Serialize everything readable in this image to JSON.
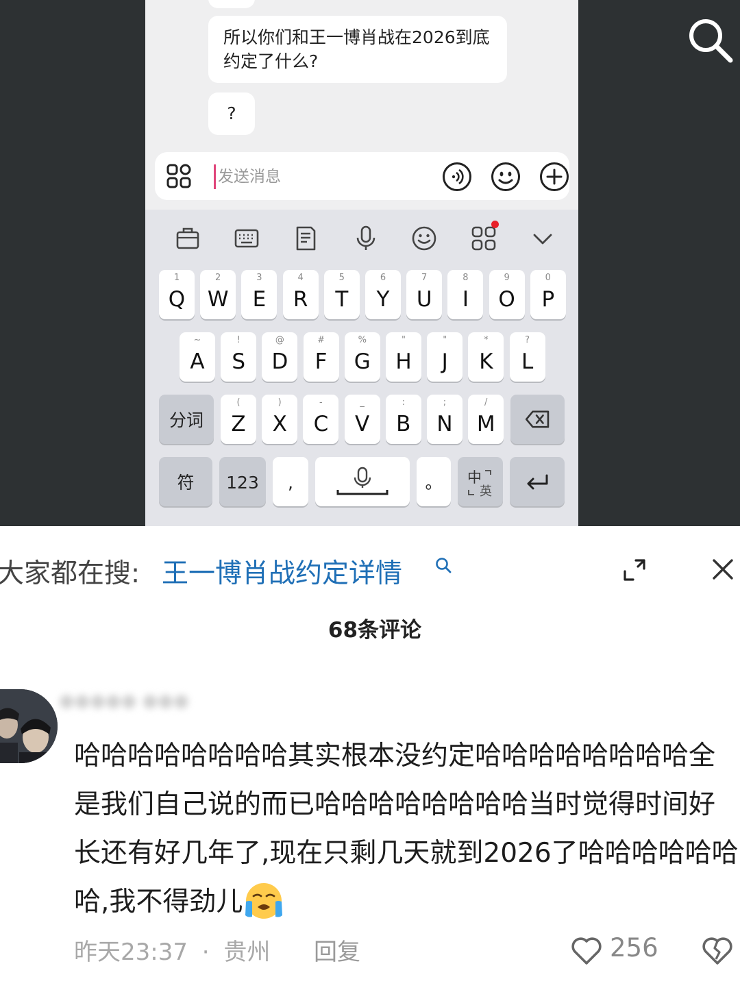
{
  "chat": {
    "messages": [
      "所以你们和王一博肖战在2026到底约定了什么?",
      "?"
    ],
    "message_line_1": "所以你们和王一博肖战在2026到底",
    "message_line_2": "约定了什么?",
    "placeholder": "发送消息"
  },
  "keyboard": {
    "tools": [
      "clipboard-icon",
      "keyboard-icon",
      "notes-icon",
      "microphone-icon",
      "emoji-icon",
      "apps-icon",
      "collapse-icon"
    ],
    "row1": [
      {
        "sup": "1",
        "key": "Q"
      },
      {
        "sup": "2",
        "key": "W"
      },
      {
        "sup": "3",
        "key": "E"
      },
      {
        "sup": "4",
        "key": "R"
      },
      {
        "sup": "5",
        "key": "T"
      },
      {
        "sup": "6",
        "key": "Y"
      },
      {
        "sup": "7",
        "key": "U"
      },
      {
        "sup": "8",
        "key": "I"
      },
      {
        "sup": "9",
        "key": "O"
      },
      {
        "sup": "0",
        "key": "P"
      }
    ],
    "row2": [
      {
        "sup": "~",
        "key": "A"
      },
      {
        "sup": "!",
        "key": "S"
      },
      {
        "sup": "@",
        "key": "D"
      },
      {
        "sup": "#",
        "key": "F"
      },
      {
        "sup": "%",
        "key": "G"
      },
      {
        "sup": "\"",
        "key": "H"
      },
      {
        "sup": "\"",
        "key": "J"
      },
      {
        "sup": "*",
        "key": "K"
      },
      {
        "sup": "?",
        "key": "L"
      }
    ],
    "row3_left": "分词",
    "row3": [
      {
        "sup": "(",
        "key": "Z"
      },
      {
        "sup": ")",
        "key": "X"
      },
      {
        "sup": "-",
        "key": "C"
      },
      {
        "sup": "_",
        "key": "V"
      },
      {
        "sup": ":",
        "key": "B"
      },
      {
        "sup": ";",
        "key": "N"
      },
      {
        "sup": "/",
        "key": "M"
      }
    ],
    "symbols_key": "符",
    "numbers_key": "123",
    "comma_key": ",",
    "period_key": "。",
    "lang_key_top": "中",
    "lang_key_bottom": "英"
  },
  "trending": {
    "label": "大家都在搜:",
    "link": "王一博肖战约定详情"
  },
  "comments": {
    "count_label": "68条评论",
    "item": {
      "text": "哈哈哈哈哈哈哈哈其实根本没约定哈哈哈哈哈哈哈哈全是我们自己说的而已哈哈哈哈哈哈哈哈当时觉得时间好长还有好几年了,现在只剩几天就到2026了哈哈哈哈哈哈哈,我不得劲儿",
      "time": "昨天23:37",
      "separator": "·",
      "location": "贵州",
      "reply_label": "回复",
      "likes": "256"
    }
  },
  "colors": {
    "link": "#1f6fb6",
    "dark_bg": "#2d3133",
    "cursor": "#e0457a",
    "badge": "#e8202a"
  }
}
